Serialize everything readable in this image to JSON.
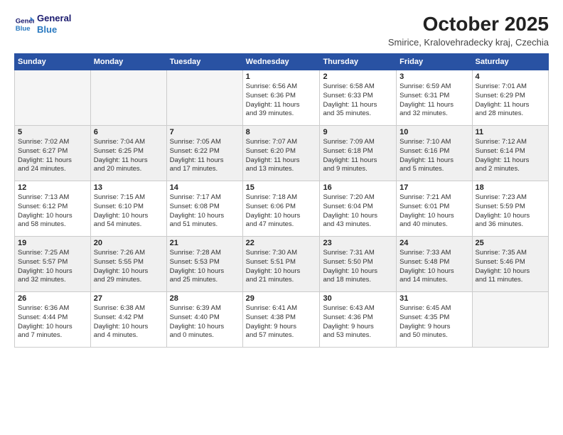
{
  "logo": {
    "line1": "General",
    "line2": "Blue"
  },
  "title": "October 2025",
  "location": "Smirice, Kralovehradecky kraj, Czechia",
  "days_of_week": [
    "Sunday",
    "Monday",
    "Tuesday",
    "Wednesday",
    "Thursday",
    "Friday",
    "Saturday"
  ],
  "weeks": [
    [
      {
        "num": "",
        "text": ""
      },
      {
        "num": "",
        "text": ""
      },
      {
        "num": "",
        "text": ""
      },
      {
        "num": "1",
        "text": "Sunrise: 6:56 AM\nSunset: 6:36 PM\nDaylight: 11 hours\nand 39 minutes."
      },
      {
        "num": "2",
        "text": "Sunrise: 6:58 AM\nSunset: 6:33 PM\nDaylight: 11 hours\nand 35 minutes."
      },
      {
        "num": "3",
        "text": "Sunrise: 6:59 AM\nSunset: 6:31 PM\nDaylight: 11 hours\nand 32 minutes."
      },
      {
        "num": "4",
        "text": "Sunrise: 7:01 AM\nSunset: 6:29 PM\nDaylight: 11 hours\nand 28 minutes."
      }
    ],
    [
      {
        "num": "5",
        "text": "Sunrise: 7:02 AM\nSunset: 6:27 PM\nDaylight: 11 hours\nand 24 minutes."
      },
      {
        "num": "6",
        "text": "Sunrise: 7:04 AM\nSunset: 6:25 PM\nDaylight: 11 hours\nand 20 minutes."
      },
      {
        "num": "7",
        "text": "Sunrise: 7:05 AM\nSunset: 6:22 PM\nDaylight: 11 hours\nand 17 minutes."
      },
      {
        "num": "8",
        "text": "Sunrise: 7:07 AM\nSunset: 6:20 PM\nDaylight: 11 hours\nand 13 minutes."
      },
      {
        "num": "9",
        "text": "Sunrise: 7:09 AM\nSunset: 6:18 PM\nDaylight: 11 hours\nand 9 minutes."
      },
      {
        "num": "10",
        "text": "Sunrise: 7:10 AM\nSunset: 6:16 PM\nDaylight: 11 hours\nand 5 minutes."
      },
      {
        "num": "11",
        "text": "Sunrise: 7:12 AM\nSunset: 6:14 PM\nDaylight: 11 hours\nand 2 minutes."
      }
    ],
    [
      {
        "num": "12",
        "text": "Sunrise: 7:13 AM\nSunset: 6:12 PM\nDaylight: 10 hours\nand 58 minutes."
      },
      {
        "num": "13",
        "text": "Sunrise: 7:15 AM\nSunset: 6:10 PM\nDaylight: 10 hours\nand 54 minutes."
      },
      {
        "num": "14",
        "text": "Sunrise: 7:17 AM\nSunset: 6:08 PM\nDaylight: 10 hours\nand 51 minutes."
      },
      {
        "num": "15",
        "text": "Sunrise: 7:18 AM\nSunset: 6:06 PM\nDaylight: 10 hours\nand 47 minutes."
      },
      {
        "num": "16",
        "text": "Sunrise: 7:20 AM\nSunset: 6:04 PM\nDaylight: 10 hours\nand 43 minutes."
      },
      {
        "num": "17",
        "text": "Sunrise: 7:21 AM\nSunset: 6:01 PM\nDaylight: 10 hours\nand 40 minutes."
      },
      {
        "num": "18",
        "text": "Sunrise: 7:23 AM\nSunset: 5:59 PM\nDaylight: 10 hours\nand 36 minutes."
      }
    ],
    [
      {
        "num": "19",
        "text": "Sunrise: 7:25 AM\nSunset: 5:57 PM\nDaylight: 10 hours\nand 32 minutes."
      },
      {
        "num": "20",
        "text": "Sunrise: 7:26 AM\nSunset: 5:55 PM\nDaylight: 10 hours\nand 29 minutes."
      },
      {
        "num": "21",
        "text": "Sunrise: 7:28 AM\nSunset: 5:53 PM\nDaylight: 10 hours\nand 25 minutes."
      },
      {
        "num": "22",
        "text": "Sunrise: 7:30 AM\nSunset: 5:51 PM\nDaylight: 10 hours\nand 21 minutes."
      },
      {
        "num": "23",
        "text": "Sunrise: 7:31 AM\nSunset: 5:50 PM\nDaylight: 10 hours\nand 18 minutes."
      },
      {
        "num": "24",
        "text": "Sunrise: 7:33 AM\nSunset: 5:48 PM\nDaylight: 10 hours\nand 14 minutes."
      },
      {
        "num": "25",
        "text": "Sunrise: 7:35 AM\nSunset: 5:46 PM\nDaylight: 10 hours\nand 11 minutes."
      }
    ],
    [
      {
        "num": "26",
        "text": "Sunrise: 6:36 AM\nSunset: 4:44 PM\nDaylight: 10 hours\nand 7 minutes."
      },
      {
        "num": "27",
        "text": "Sunrise: 6:38 AM\nSunset: 4:42 PM\nDaylight: 10 hours\nand 4 minutes."
      },
      {
        "num": "28",
        "text": "Sunrise: 6:39 AM\nSunset: 4:40 PM\nDaylight: 10 hours\nand 0 minutes."
      },
      {
        "num": "29",
        "text": "Sunrise: 6:41 AM\nSunset: 4:38 PM\nDaylight: 9 hours\nand 57 minutes."
      },
      {
        "num": "30",
        "text": "Sunrise: 6:43 AM\nSunset: 4:36 PM\nDaylight: 9 hours\nand 53 minutes."
      },
      {
        "num": "31",
        "text": "Sunrise: 6:45 AM\nSunset: 4:35 PM\nDaylight: 9 hours\nand 50 minutes."
      },
      {
        "num": "",
        "text": ""
      }
    ]
  ]
}
